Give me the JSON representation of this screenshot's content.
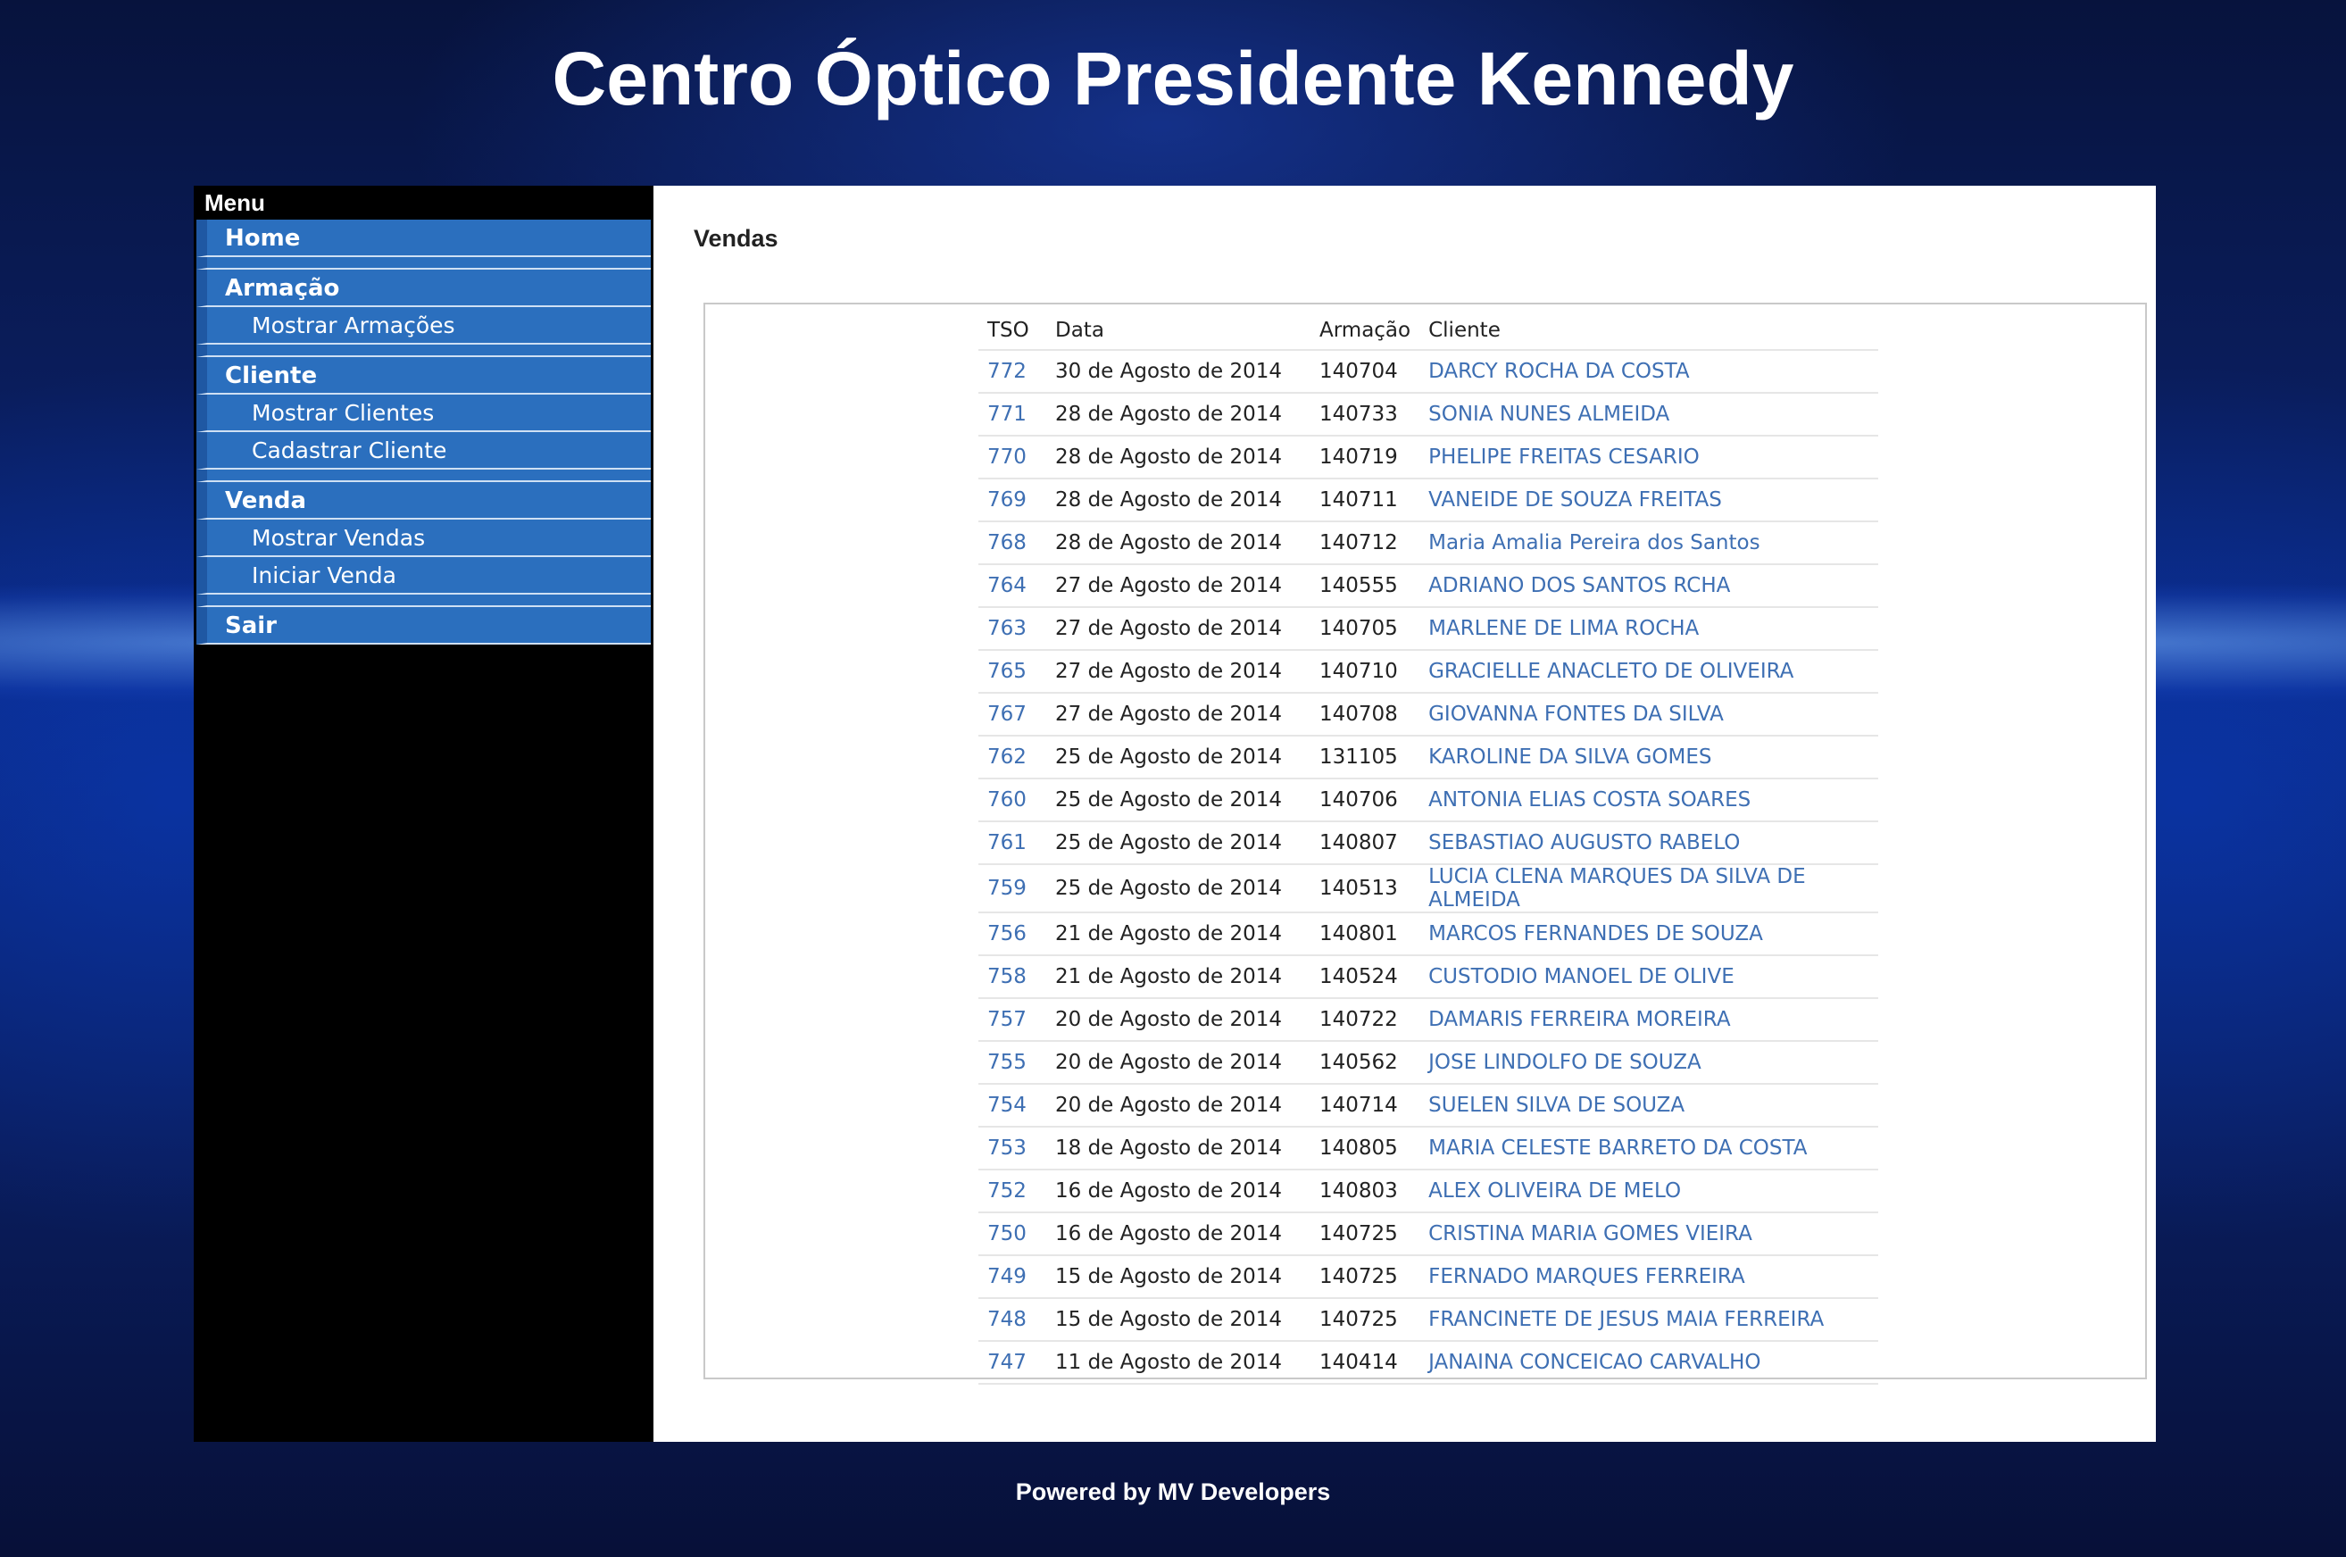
{
  "header": {
    "title": "Centro Óptico Presidente Kennedy"
  },
  "menu": {
    "title": "Menu",
    "home": "Home",
    "armacao": {
      "label": "Armação",
      "items": [
        "Mostrar Armações"
      ]
    },
    "cliente": {
      "label": "Cliente",
      "items": [
        "Mostrar Clientes",
        "Cadastrar Cliente"
      ]
    },
    "venda": {
      "label": "Venda",
      "items": [
        "Mostrar Vendas",
        "Iniciar Venda"
      ]
    },
    "sair": "Sair"
  },
  "main": {
    "title": "Vendas",
    "columns": [
      "TSO",
      "Data",
      "Armação",
      "Cliente"
    ],
    "rows": [
      {
        "tso": "772",
        "data": "30 de Agosto de 2014",
        "armacao": "140704",
        "cliente": "DARCY ROCHA DA COSTA"
      },
      {
        "tso": "771",
        "data": "28 de Agosto de 2014",
        "armacao": "140733",
        "cliente": "SONIA NUNES ALMEIDA"
      },
      {
        "tso": "770",
        "data": "28 de Agosto de 2014",
        "armacao": "140719",
        "cliente": "PHELIPE FREITAS CESARIO"
      },
      {
        "tso": "769",
        "data": "28 de Agosto de 2014",
        "armacao": "140711",
        "cliente": "VANEIDE DE SOUZA FREITAS"
      },
      {
        "tso": "768",
        "data": "28 de Agosto de 2014",
        "armacao": "140712",
        "cliente": "Maria Amalia Pereira dos Santos"
      },
      {
        "tso": "764",
        "data": "27 de Agosto de 2014",
        "armacao": "140555",
        "cliente": "ADRIANO DOS SANTOS RCHA"
      },
      {
        "tso": "763",
        "data": "27 de Agosto de 2014",
        "armacao": "140705",
        "cliente": "MARLENE DE LIMA ROCHA"
      },
      {
        "tso": "765",
        "data": "27 de Agosto de 2014",
        "armacao": "140710",
        "cliente": "GRACIELLE ANACLETO DE OLIVEIRA"
      },
      {
        "tso": "767",
        "data": "27 de Agosto de 2014",
        "armacao": "140708",
        "cliente": "GIOVANNA FONTES DA SILVA"
      },
      {
        "tso": "762",
        "data": "25 de Agosto de 2014",
        "armacao": "131105",
        "cliente": "KAROLINE DA SILVA GOMES"
      },
      {
        "tso": "760",
        "data": "25 de Agosto de 2014",
        "armacao": "140706",
        "cliente": "ANTONIA ELIAS COSTA SOARES"
      },
      {
        "tso": "761",
        "data": "25 de Agosto de 2014",
        "armacao": "140807",
        "cliente": "SEBASTIAO AUGUSTO RABELO"
      },
      {
        "tso": "759",
        "data": "25 de Agosto de 2014",
        "armacao": "140513",
        "cliente": "LUCIA CLENA MARQUES DA SILVA DE ALMEIDA"
      },
      {
        "tso": "756",
        "data": "21 de Agosto de 2014",
        "armacao": "140801",
        "cliente": "MARCOS FERNANDES DE SOUZA"
      },
      {
        "tso": "758",
        "data": "21 de Agosto de 2014",
        "armacao": "140524",
        "cliente": "CUSTODIO MANOEL DE OLIVE"
      },
      {
        "tso": "757",
        "data": "20 de Agosto de 2014",
        "armacao": "140722",
        "cliente": "DAMARIS FERREIRA MOREIRA"
      },
      {
        "tso": "755",
        "data": "20 de Agosto de 2014",
        "armacao": "140562",
        "cliente": "JOSE LINDOLFO DE SOUZA"
      },
      {
        "tso": "754",
        "data": "20 de Agosto de 2014",
        "armacao": "140714",
        "cliente": "SUELEN SILVA DE SOUZA"
      },
      {
        "tso": "753",
        "data": "18 de Agosto de 2014",
        "armacao": "140805",
        "cliente": "MARIA CELESTE BARRETO DA COSTA"
      },
      {
        "tso": "752",
        "data": "16 de Agosto de 2014",
        "armacao": "140803",
        "cliente": "ALEX OLIVEIRA DE MELO"
      },
      {
        "tso": "750",
        "data": "16 de Agosto de 2014",
        "armacao": "140725",
        "cliente": "CRISTINA MARIA GOMES VIEIRA"
      },
      {
        "tso": "749",
        "data": "15 de Agosto de 2014",
        "armacao": "140725",
        "cliente": "FERNADO MARQUES FERREIRA"
      },
      {
        "tso": "748",
        "data": "15 de Agosto de 2014",
        "armacao": "140725",
        "cliente": "FRANCINETE DE JESUS MAIA FERREIRA"
      },
      {
        "tso": "747",
        "data": "11 de Agosto de 2014",
        "armacao": "140414",
        "cliente": "JANAINA CONCEICAO CARVALHO"
      }
    ]
  },
  "footer": {
    "text": "Powered by MV Developers"
  }
}
